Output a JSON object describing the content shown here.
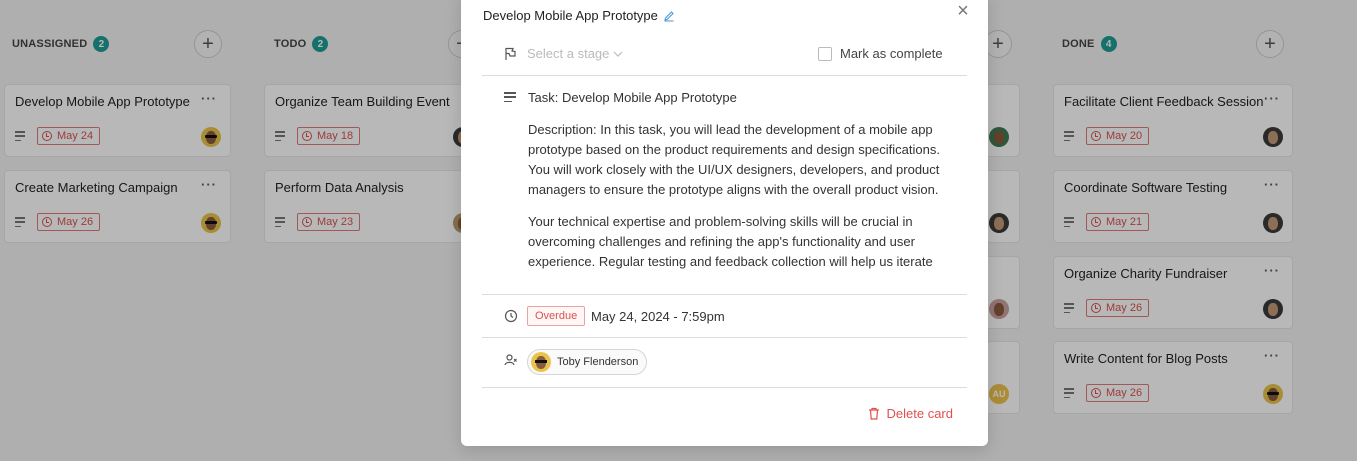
{
  "board": {
    "columns": [
      {
        "title": "UNASSIGNED",
        "count": "2",
        "cards": [
          {
            "title": "Develop Mobile App Prototype",
            "date": "May 24"
          },
          {
            "title": "Create Marketing Campaign",
            "date": "May 26"
          }
        ]
      },
      {
        "title": "TODO",
        "count": "2",
        "cards": [
          {
            "title": "Organize Team Building Event",
            "date": "May 18"
          },
          {
            "title": "Perform Data Analysis",
            "date": "May 23"
          }
        ]
      },
      {
        "title": "DONE",
        "count": "4",
        "cards": [
          {
            "title": "Facilitate Client Feedback Session",
            "date": "May 20"
          },
          {
            "title": "Coordinate Software Testing",
            "date": "May 21"
          },
          {
            "title": "Organize Charity Fundraiser",
            "date": "May 26"
          },
          {
            "title": "Write Content for Blog Posts",
            "date": "May 26"
          }
        ]
      }
    ],
    "hidden_column_avatar_initials": "AU",
    "card_menu_label": "···",
    "add_label": "+"
  },
  "modal": {
    "title": "Develop Mobile App Prototype",
    "close_label": "×",
    "stage_placeholder": "Select a stage",
    "mark_complete_label": "Mark as complete",
    "task_line": "Task: Develop Mobile App Prototype",
    "description_p1": "Description: In this task, you will lead the development of a mobile app prototype based on the product requirements and design specifications. You will work closely with the UI/UX designers, developers, and product managers to ensure the prototype aligns with the overall product vision.",
    "description_p2": "Your technical expertise and problem-solving skills will be crucial in overcoming challenges and refining the app's functionality and user experience. Regular testing and feedback collection will help us iterate an...",
    "status_badge": "Overdue",
    "due_date": "May 24, 2024 - 7:59pm",
    "assignee": "Toby Flenderson",
    "delete_label": "Delete card"
  },
  "colors": {
    "accent": "#1f9c96",
    "danger": "#e0504d",
    "link": "#4a90d9"
  }
}
